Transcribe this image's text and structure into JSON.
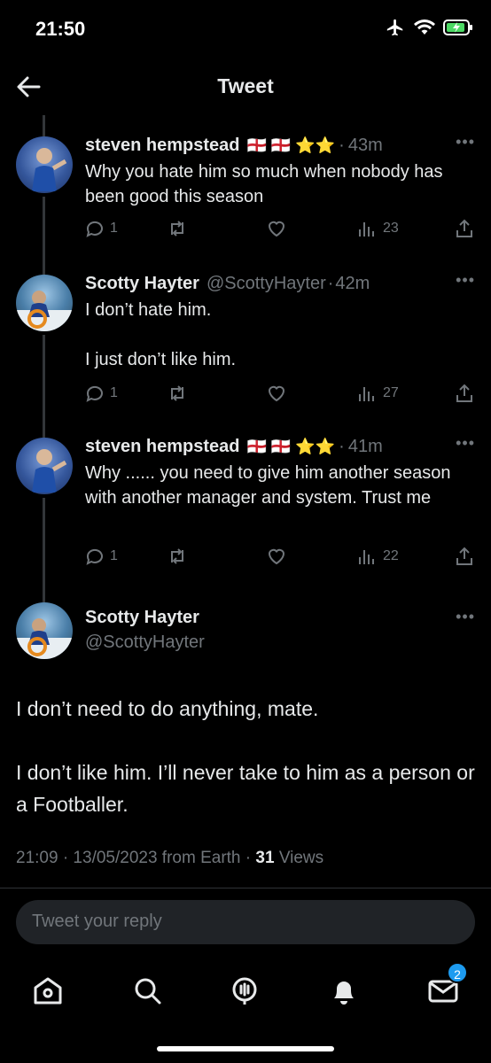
{
  "status": {
    "time": "21:50"
  },
  "header": {
    "title": "Tweet"
  },
  "replies": [
    {
      "name": "steven hempstead",
      "badges": "🏴󠁧󠁢󠁥󠁮󠁧󠁿 🏴󠁧󠁢󠁥󠁮󠁧󠁿 ⭐⭐",
      "handle": "",
      "time": "43m",
      "text": "Why you hate him so much when nobody has been good this season",
      "replies": "1",
      "retweets": "",
      "likes": "",
      "views": "23"
    },
    {
      "name": "Scotty Hayter",
      "badges": "",
      "handle": "@ScottyHayter",
      "time": "42m",
      "text": "I don’t hate him.\n\nI just don’t like him.",
      "replies": "1",
      "retweets": "",
      "likes": "",
      "views": "27"
    },
    {
      "name": "steven hempstead",
      "badges": "🏴󠁧󠁢󠁥󠁮󠁧󠁿 🏴󠁧󠁢󠁥󠁮󠁧󠁿 ⭐⭐",
      "handle": "",
      "time": "41m",
      "text": "Why ...... you need to give him another season with another manager and system. Trust me",
      "replies": "1",
      "retweets": "",
      "likes": "",
      "views": "22"
    }
  ],
  "main_tweet": {
    "name": "Scotty Hayter",
    "handle": "@ScottyHayter",
    "text": "I don’t need to do anything, mate.\n\nI don’t like him. I’ll never take to him as a person or a Footballer.",
    "timestamp": "21:09 · 13/05/2023 from Earth",
    "views_count": "31",
    "views_label": "Views"
  },
  "reply_box": {
    "placeholder": "Tweet your reply"
  },
  "tabbar": {
    "messages_badge": "2"
  },
  "icons": {
    "back": "arrow-left-icon",
    "reply": "speech-bubble-icon",
    "retweet": "retweet-icon",
    "like": "heart-icon",
    "views": "bar-chart-icon",
    "share": "share-icon",
    "home": "home-icon",
    "search": "search-icon",
    "spaces": "microphone-icon",
    "notifications": "bell-icon",
    "messages": "envelope-icon"
  },
  "colors": {
    "accent": "#1d9bf0",
    "background": "#000000",
    "muted": "#71767b"
  }
}
